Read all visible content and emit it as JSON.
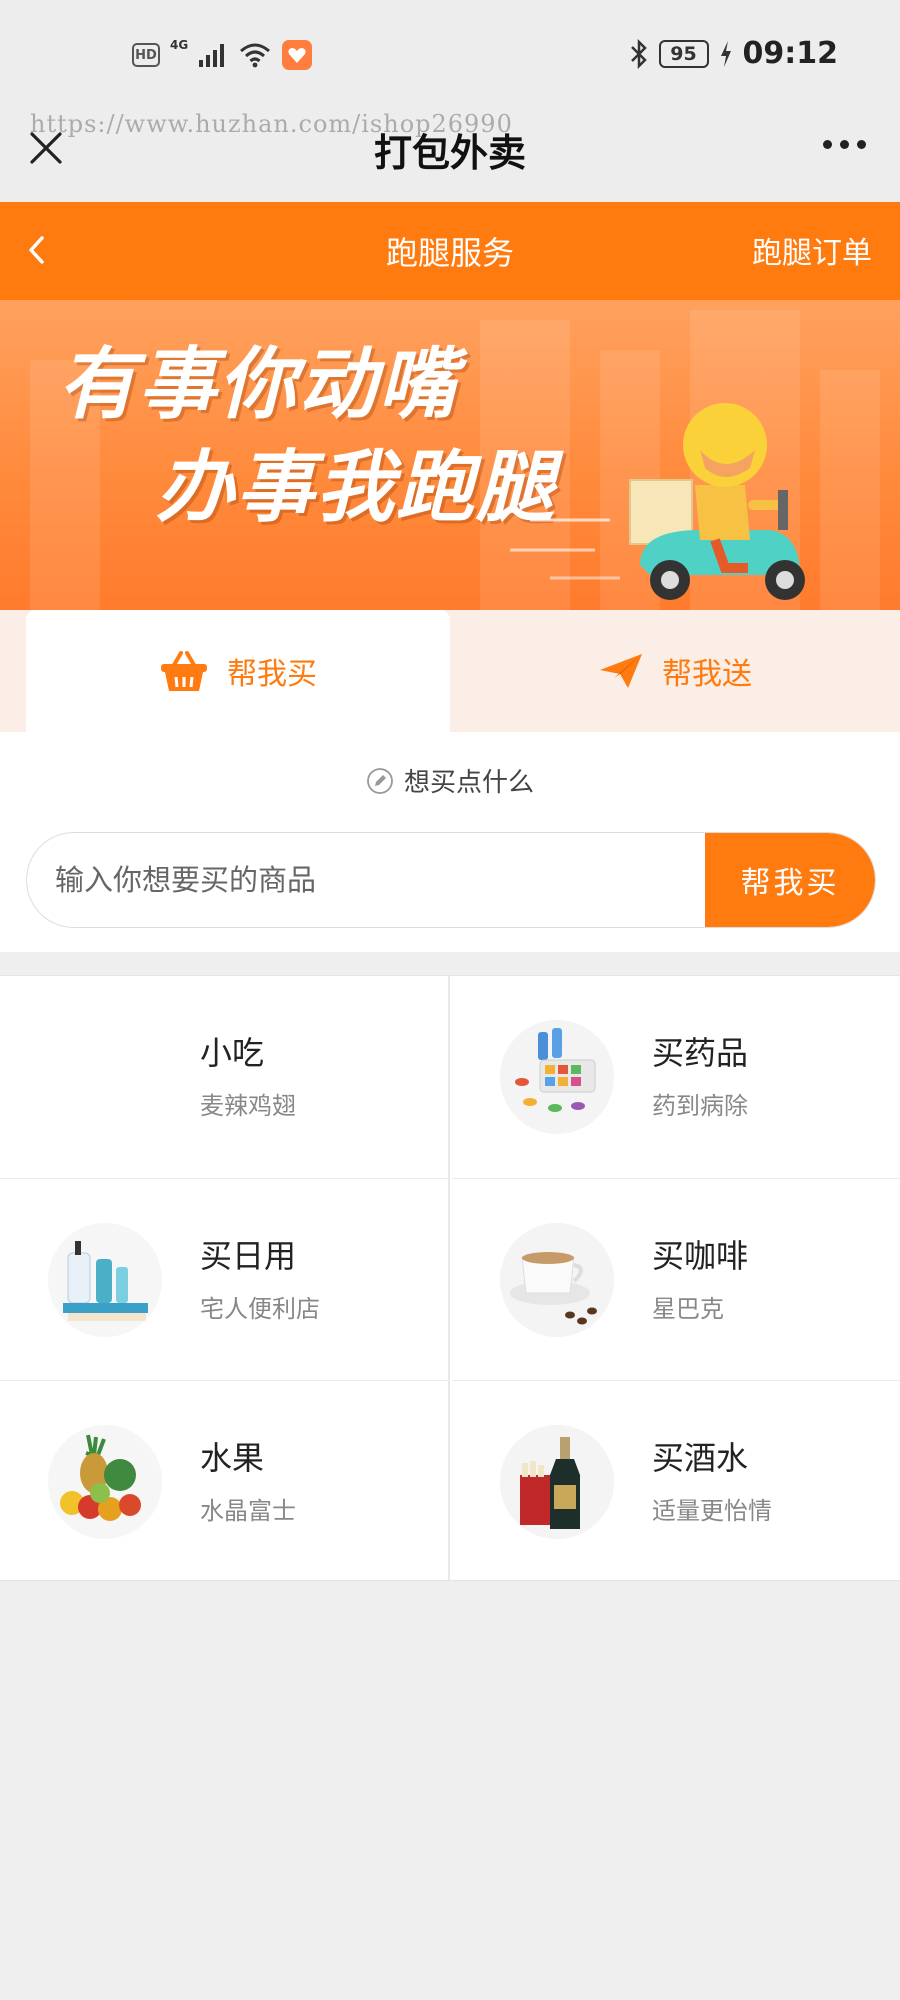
{
  "status_bar": {
    "left_badges": [
      "HD",
      "4G"
    ],
    "battery": "95",
    "time": "09:12"
  },
  "watermark": "https://www.huzhan.com/ishop26990",
  "mini_nav": {
    "title": "打包外卖"
  },
  "header": {
    "title": "跑腿服务",
    "right_link": "跑腿订单",
    "color": "#ff7a0f"
  },
  "banner": {
    "line1": "有事你动嘴",
    "line2": "办事我跑腿"
  },
  "tabs": [
    {
      "label": "帮我买",
      "icon": "basket-icon",
      "active": true
    },
    {
      "label": "帮我送",
      "icon": "paper-plane-icon",
      "active": false
    }
  ],
  "search": {
    "hint": "想买点什么",
    "placeholder": "输入你想要买的商品",
    "button": "帮我买"
  },
  "categories": [
    {
      "title": "小吃",
      "subtitle": "麦辣鸡翅",
      "icon": "snack-image"
    },
    {
      "title": "买药品",
      "subtitle": "药到病除",
      "icon": "medicine-image"
    },
    {
      "title": "买日用",
      "subtitle": "宅人便利店",
      "icon": "daily-goods-image"
    },
    {
      "title": "买咖啡",
      "subtitle": "星巴克",
      "icon": "coffee-image"
    },
    {
      "title": "水果",
      "subtitle": "水晶富士",
      "icon": "fruit-image"
    },
    {
      "title": "买酒水",
      "subtitle": "适量更怡情",
      "icon": "liquor-image"
    }
  ]
}
